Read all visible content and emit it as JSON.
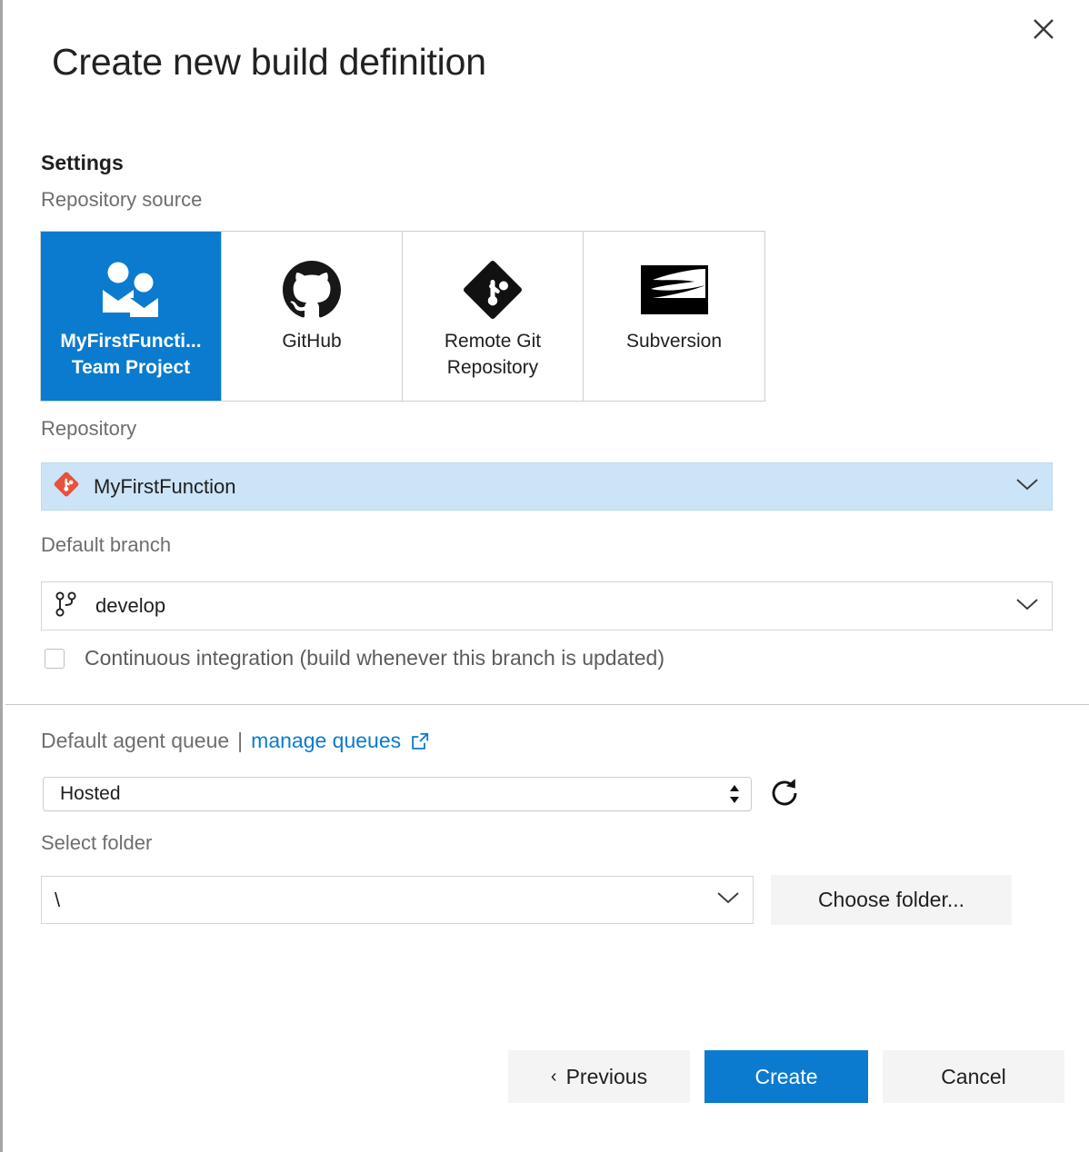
{
  "dialog": {
    "title": "Create new build definition",
    "close_icon": "close-icon"
  },
  "settings": {
    "heading": "Settings",
    "repository_source": {
      "label": "Repository source",
      "tiles": [
        {
          "label": "MyFirstFuncti...\nTeam Project",
          "line1": "MyFirstFuncti...",
          "line2": "Team Project",
          "icon": "team-project-icon",
          "selected": true
        },
        {
          "label": "GitHub",
          "line1": "GitHub",
          "line2": "",
          "icon": "github-icon",
          "selected": false
        },
        {
          "label": "Remote Git Repository",
          "line1": "Remote Git",
          "line2": "Repository",
          "icon": "git-icon",
          "selected": false
        },
        {
          "label": "Subversion",
          "line1": "Subversion",
          "line2": "",
          "icon": "subversion-icon",
          "selected": false
        }
      ]
    },
    "repository": {
      "label": "Repository",
      "value": "MyFirstFunction",
      "icon": "git-diamond-icon",
      "chevron": "chevron-down-icon"
    },
    "default_branch": {
      "label": "Default branch",
      "value": "develop",
      "icon": "git-branch-icon",
      "chevron": "chevron-down-icon"
    },
    "continuous_integration": {
      "label": "Continuous integration (build whenever this branch is updated)",
      "checked": false
    }
  },
  "agent_queue": {
    "label": "Default agent queue",
    "separator": "|",
    "manage_link": "manage queues",
    "external_icon": "external-link-icon",
    "value": "Hosted",
    "refresh_icon": "refresh-icon"
  },
  "folder": {
    "label": "Select folder",
    "value": "\\",
    "chevron": "chevron-down-icon",
    "choose_button": "Choose folder..."
  },
  "footer": {
    "previous": "Previous",
    "previous_caret": "‹",
    "create": "Create",
    "cancel": "Cancel"
  },
  "colors": {
    "accent": "#0a7bcf",
    "selection_bg": "#cce4f7",
    "git_orange": "#e8513a",
    "label_gray": "#6e6e6e"
  }
}
